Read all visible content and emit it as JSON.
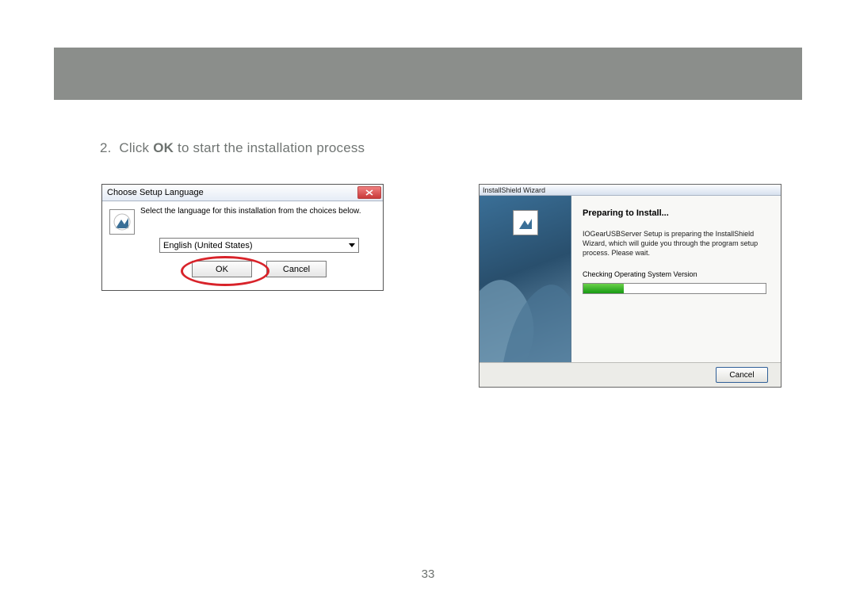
{
  "instruction": {
    "prefix": "2.  Click ",
    "bold": "OK",
    "suffix": " to start the installation process"
  },
  "dialog1": {
    "title": "Choose Setup Language",
    "message": "Select the language for this installation from the choices below.",
    "language": "English (United States)",
    "ok": "OK",
    "cancel": "Cancel"
  },
  "dialog2": {
    "title": "InstallShield Wizard",
    "heading": "Preparing to Install...",
    "body": "IOGearUSBServer Setup is preparing the InstallShield Wizard, which will guide you through the program setup process. Please wait.",
    "status": "Checking Operating System Version",
    "cancel": "Cancel"
  },
  "page": {
    "number": "33"
  }
}
